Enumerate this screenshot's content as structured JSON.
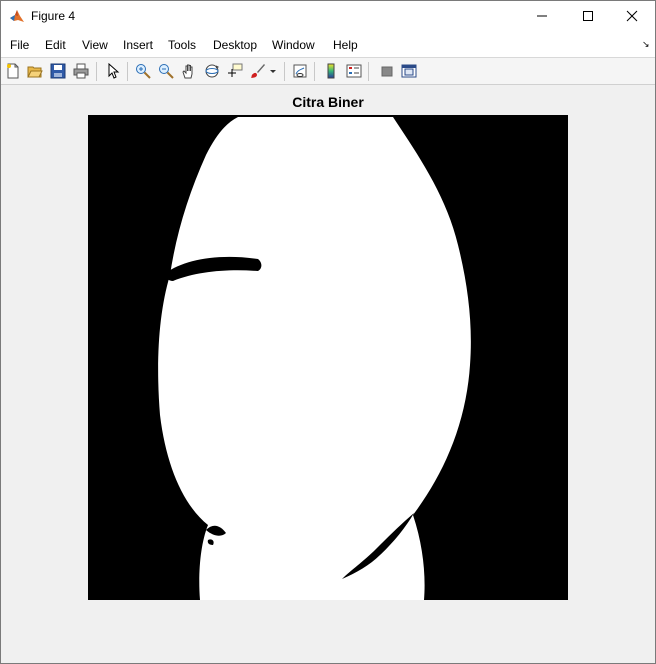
{
  "window": {
    "title": "Figure 4",
    "controls": {
      "minimize": "—",
      "maximize": "☐",
      "close": "✕"
    }
  },
  "menubar": {
    "items": [
      "File",
      "Edit",
      "View",
      "Insert",
      "Tools",
      "Desktop",
      "Window",
      "Help"
    ]
  },
  "toolbar": {
    "buttons": [
      "new-figure-icon",
      "open-file-icon",
      "save-icon",
      "print-icon",
      "edit-plot-arrow-icon",
      "zoom-in-icon",
      "zoom-out-icon",
      "pan-hand-icon",
      "rotate-3d-icon",
      "data-cursor-icon",
      "brush-icon",
      "link-plot-icon",
      "colorbar-icon",
      "legend-icon",
      "hide-plot-tools-icon",
      "show-plot-tools-icon"
    ]
  },
  "figure": {
    "axes_title": "Citra Biner",
    "colors": {
      "foreground": "#ffffff",
      "background": "#000000"
    }
  }
}
